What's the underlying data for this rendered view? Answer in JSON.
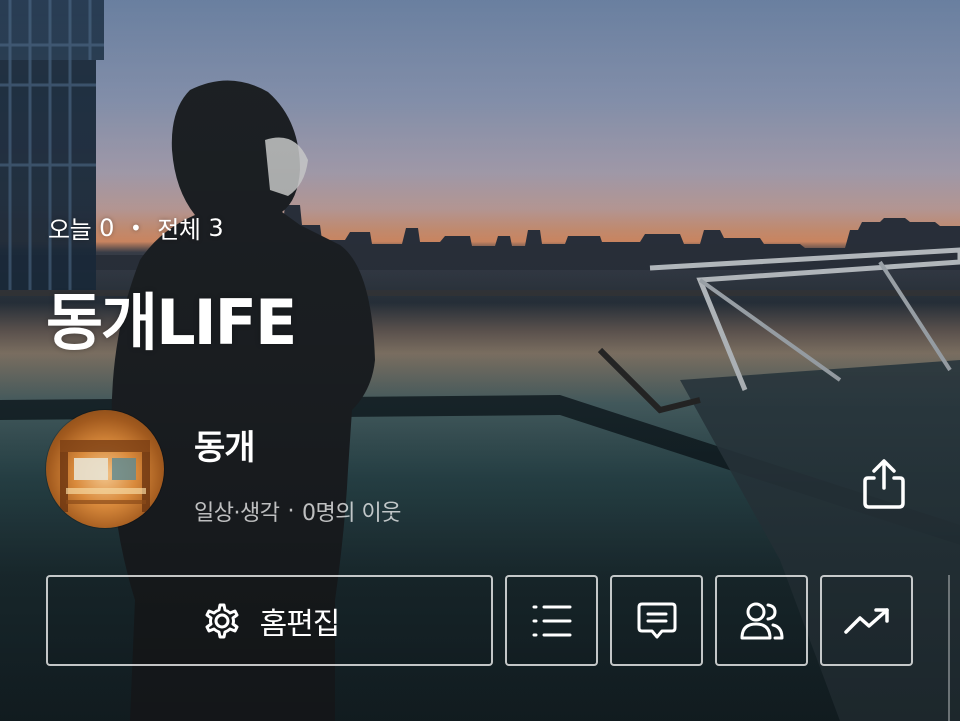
{
  "header": {
    "today_label": "오늘",
    "today_count": "0",
    "total_label": "전체",
    "total_count": "3",
    "separator": "•",
    "blog_title": "동개LIFE"
  },
  "profile": {
    "nickname": "동개",
    "category": "일상·생각",
    "neighbors": "0명의 이웃",
    "meta_separator": "·"
  },
  "actions": {
    "edit_home_label": "홈편집",
    "buttons": [
      "list-icon",
      "comment-icon",
      "neighbor-icon",
      "stats-icon"
    ],
    "share_icon": "share-icon"
  },
  "colors": {
    "text": "#ffffff",
    "border": "#ffffff"
  }
}
